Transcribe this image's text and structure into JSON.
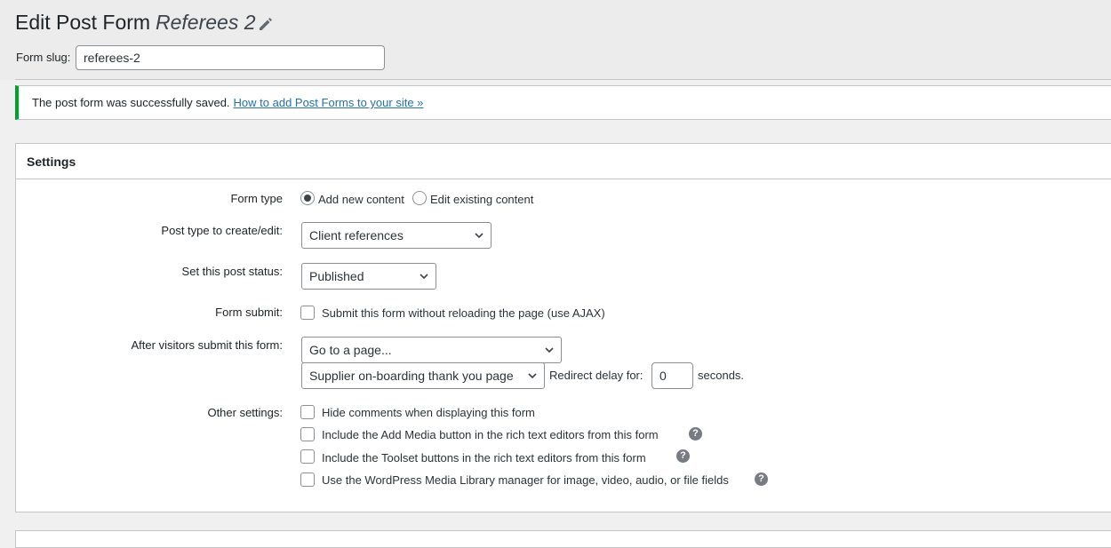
{
  "header": {
    "title": "Edit Post Form",
    "form_name": "Referees 2",
    "slug_label": "Form slug:",
    "slug_value": "referees-2",
    "edit_icon": "pencil-icon"
  },
  "notice": {
    "message": "The post form was successfully saved.",
    "link": "How to add Post Forms to your site »",
    "accent_color": "#00a32a"
  },
  "settings": {
    "title": "Settings",
    "form_type": {
      "label": "Form type",
      "options": [
        "Add new content",
        "Edit existing content"
      ],
      "selected": "Add new content"
    },
    "post_type": {
      "label": "Post type to create/edit:",
      "value": "Client references"
    },
    "post_status": {
      "label": "Set this post status:",
      "value": "Published"
    },
    "form_submit": {
      "label": "Form submit:",
      "checkbox": "Submit this form without reloading the page (use AJAX)",
      "checked": false
    },
    "after_submit": {
      "label": "After visitors submit this form:",
      "action": "Go to a page...",
      "page": "Supplier on-boarding thank you page",
      "delay_label": "Redirect delay for:",
      "delay_value": "0",
      "delay_unit": "seconds."
    },
    "other": {
      "label": "Other settings:",
      "options": [
        {
          "text": "Hide comments when displaying this form",
          "checked": false,
          "help": false
        },
        {
          "text": "Include the Add Media button in the rich text editors from this form",
          "checked": false,
          "help": true
        },
        {
          "text": "Include the Toolset buttons in the rich text editors from this form",
          "checked": false,
          "help": true
        },
        {
          "text": "Use the WordPress Media Library manager for image, video, audio, or file fields",
          "checked": false,
          "help": true
        }
      ],
      "help_glyph": "?"
    }
  }
}
